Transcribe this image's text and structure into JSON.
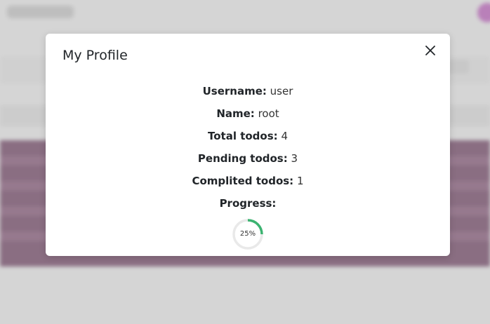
{
  "modal": {
    "title": "My Profile",
    "fields": [
      {
        "label": "Username:",
        "value": "user"
      },
      {
        "label": "Name:",
        "value": "root"
      },
      {
        "label": "Total todos:",
        "value": "4"
      },
      {
        "label": "Pending todos:",
        "value": "3"
      },
      {
        "label": "Complited todos:",
        "value": "1"
      },
      {
        "label": "Progress:",
        "value": ""
      }
    ],
    "progress": {
      "percent": 25,
      "label": "25%",
      "color": "#3cb371",
      "track_color": "#e9e9e9"
    },
    "close_icon": "close-icon"
  },
  "colors": {
    "backdrop": "#d8d8d8",
    "table_bg": "#7f5e76",
    "avatar": "#b774b7"
  }
}
